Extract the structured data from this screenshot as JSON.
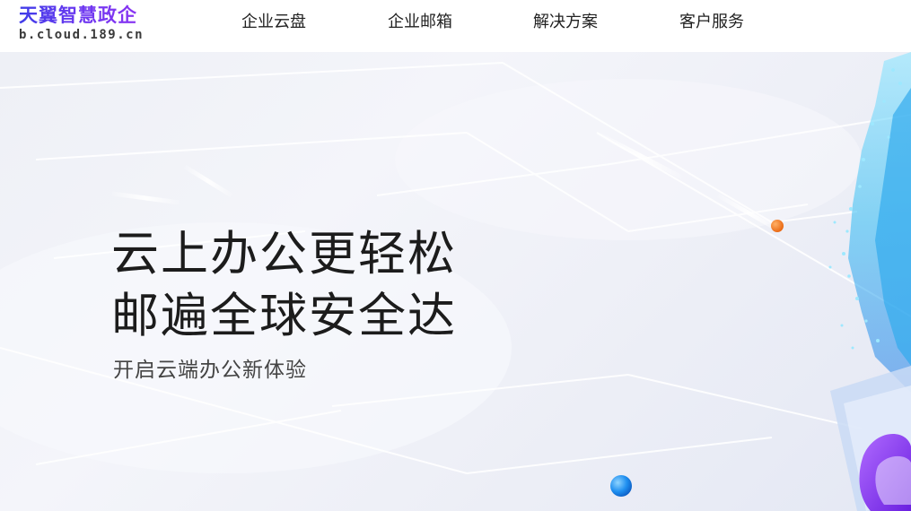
{
  "header": {
    "logo": {
      "name": "天翼智慧政企",
      "url": "b.cloud.189.cn"
    },
    "nav": [
      {
        "label": "企业云盘"
      },
      {
        "label": "企业邮箱"
      },
      {
        "label": "解决方案"
      },
      {
        "label": "客户服务"
      }
    ]
  },
  "hero": {
    "headline_line1": "云上办公更轻松",
    "headline_line2": "邮遍全球安全达",
    "subheadline": "开启云端办公新体验"
  },
  "colors": {
    "brand_purple": "#6b38f0",
    "accent_orange": "#f07a1a",
    "accent_blue": "#1e8ff0"
  }
}
